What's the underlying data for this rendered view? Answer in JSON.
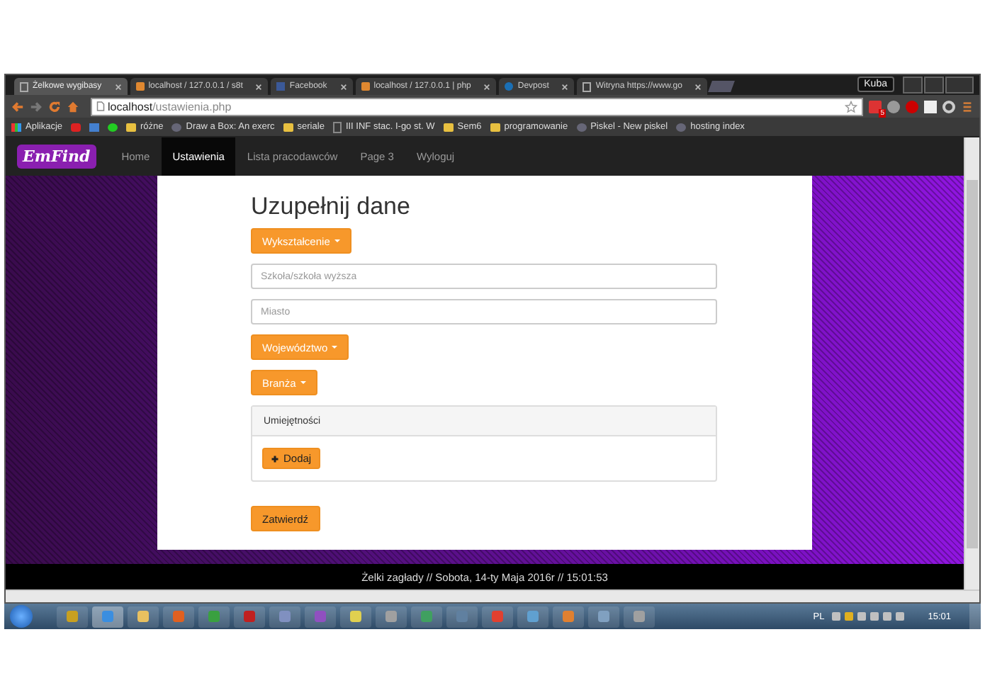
{
  "window": {
    "user": "Kuba"
  },
  "tabs": [
    {
      "label": "Żelkowe wygibasy",
      "selected": true
    },
    {
      "label": "localhost / 127.0.0.1 / s8t",
      "selected": false
    },
    {
      "label": "Facebook",
      "selected": false
    },
    {
      "label": "localhost / 127.0.0.1 | php",
      "selected": false
    },
    {
      "label": "Devpost",
      "selected": false
    },
    {
      "label": "Witryna https://www.go",
      "selected": false
    }
  ],
  "address": {
    "host": "localhost",
    "path": "/ustawienia.php"
  },
  "mail_badge": "5",
  "bookmarks": [
    {
      "label": "Aplikacje"
    },
    {
      "label": "różne"
    },
    {
      "label": "Draw a Box: An exerc"
    },
    {
      "label": "seriale"
    },
    {
      "label": "III INF stac. I-go st. W"
    },
    {
      "label": "Sem6"
    },
    {
      "label": "programowanie"
    },
    {
      "label": "Piskel - New piskel"
    },
    {
      "label": "hosting index"
    }
  ],
  "navbar": {
    "brand": "EmFind",
    "items": [
      {
        "label": "Home",
        "selected": false
      },
      {
        "label": "Ustawienia",
        "selected": true
      },
      {
        "label": "Lista pracodawców",
        "selected": false
      },
      {
        "label": "Page 3",
        "selected": false
      },
      {
        "label": "Wyloguj",
        "selected": false
      }
    ]
  },
  "form": {
    "title": "Uzupełnij dane",
    "fields": [
      {
        "kind": "dropdown",
        "label": "Wykształcenie"
      },
      {
        "kind": "input",
        "placeholder": "Szkoła/szkoła wyższa"
      },
      {
        "kind": "input",
        "placeholder": "Miasto"
      },
      {
        "kind": "dropdown",
        "label": "Województwo"
      },
      {
        "kind": "dropdown",
        "label": "Branża"
      }
    ],
    "panel": {
      "heading": "Umiejętności",
      "button": "Dodaj"
    },
    "submit": "Zatwierdź"
  },
  "footer": "Żelki zagłady // Sobota, 14-ty Maja 2016r // 15:01:53",
  "taskbar": {
    "language": "PL",
    "clock": "15:01"
  }
}
